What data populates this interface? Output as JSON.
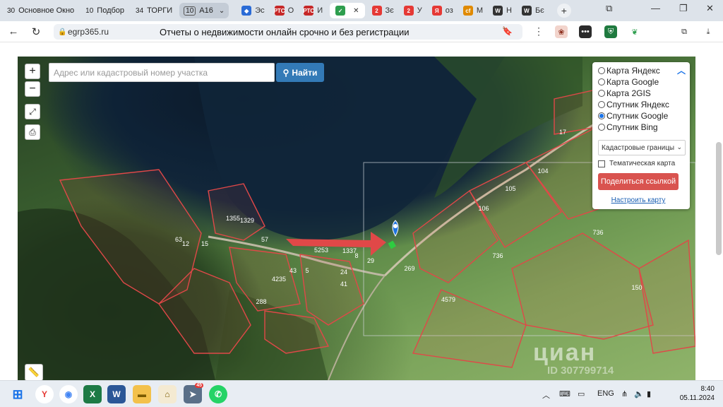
{
  "tabs": {
    "groups": [
      {
        "count": "30",
        "label": "Основное Окно"
      },
      {
        "count": "10",
        "label": "Подбор"
      },
      {
        "count": "34",
        "label": "ТОРГИ"
      },
      {
        "count": "10",
        "label": "А16"
      }
    ],
    "mini": [
      {
        "label": "Эс",
        "color": "#2a6bd6",
        "glyph": "◆"
      },
      {
        "label": "О",
        "color": "#c62828",
        "glyph": "РТС"
      },
      {
        "label": "И",
        "color": "#c62828",
        "glyph": "РТС"
      },
      {
        "label": "",
        "color": "#2e9e4e",
        "glyph": "✓"
      },
      {
        "label": "Зє",
        "color": "#e53935",
        "glyph": "2"
      },
      {
        "label": "У",
        "color": "#e53935",
        "glyph": "2"
      },
      {
        "label": "оз",
        "color": "#e53935",
        "glyph": "Я"
      },
      {
        "label": "М",
        "color": "#e08a00",
        "glyph": "cf"
      },
      {
        "label": "Н",
        "color": "#333333",
        "glyph": "W"
      },
      {
        "label": "Бє",
        "color": "#333333",
        "glyph": "W"
      }
    ]
  },
  "address": {
    "host": "egrp365.ru",
    "title": "Отчеты о недвижимости онлайн срочно и без регистрации"
  },
  "map": {
    "search_placeholder": "Адрес или кадастровый номер участка",
    "search_button": "Найти",
    "zoom_in": "+",
    "zoom_out": "−",
    "layers": [
      {
        "label": "Карта Яндекс",
        "selected": false
      },
      {
        "label": "Карта Google",
        "selected": false
      },
      {
        "label": "Карта 2GIS",
        "selected": false
      },
      {
        "label": "Спутник Яндекс",
        "selected": false
      },
      {
        "label": "Спутник Google",
        "selected": true
      },
      {
        "label": "Спутник Bing",
        "selected": false
      }
    ],
    "layer_select": "Кадастровые границы",
    "thematic_label": "Тематическая карта",
    "share_button": "Поделиться ссылкой",
    "setup_link": "Настроить карту",
    "plot_labels": [
      "17",
      "104",
      "105",
      "106",
      "736",
      "736",
      "150",
      "4579",
      "269",
      "29",
      "41",
      "24",
      "5",
      "43",
      "4235",
      "5253",
      "1355",
      "8",
      "1337",
      "15",
      "63",
      "12",
      "57",
      "1329",
      "288"
    ],
    "watermark": "циан",
    "watermark_id": "ID 307799714"
  },
  "taskbar": {
    "lang": "ENG",
    "time": "8:40",
    "date": "05.11.2024",
    "telegram_badge": "45"
  },
  "colors": {
    "accent": "#337ab7",
    "share": "#d9534f",
    "parcel": "#e04848"
  }
}
